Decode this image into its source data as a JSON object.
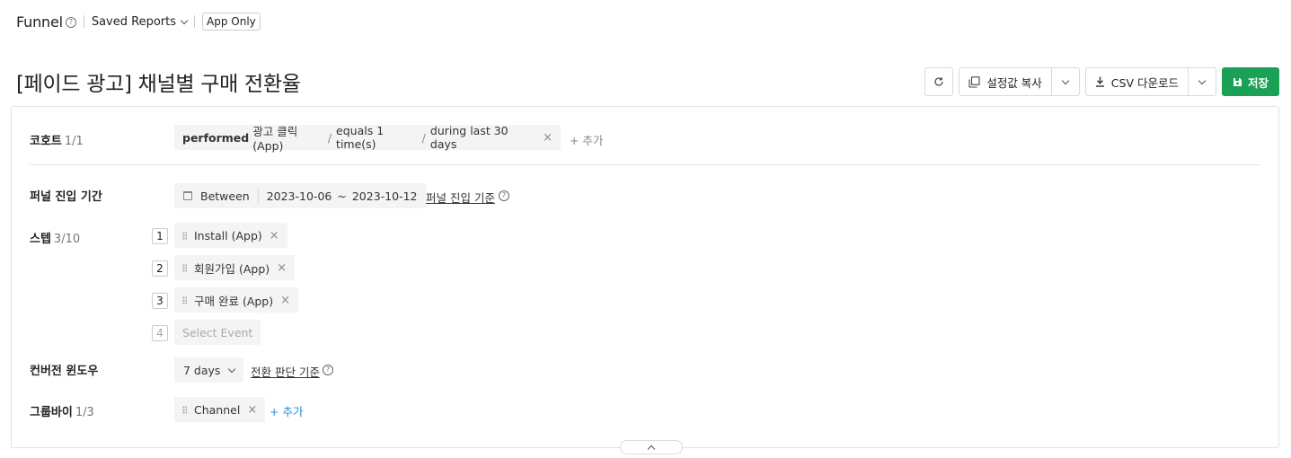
{
  "topbar": {
    "app_title": "Funnel",
    "help_glyph": "?",
    "saved_reports_label": "Saved Reports",
    "app_only_label": "App Only"
  },
  "page_title": "[페이드 광고] 채널별 구매 전환율",
  "toolbar": {
    "copy_label": "설정값 복사",
    "csv_label": "CSV 다운로드",
    "save_label": "저장"
  },
  "cohort": {
    "label": "코호트",
    "count": "1/1",
    "action": "performed",
    "event": "광고 클릭 (App)",
    "slash": "/",
    "condition": "equals 1 time(s)",
    "period": "during last 30 days",
    "remove": "×",
    "add_label": "+ 추가"
  },
  "entry_period": {
    "label": "퍼널 진입 기간",
    "mode": "Between",
    "start": "2023-10-06",
    "tilde": "~",
    "end": "2023-10-12",
    "criteria_link": "퍼널 진입 기준",
    "help_glyph": "?"
  },
  "steps": {
    "label": "스텝",
    "count": "3/10",
    "items": [
      {
        "num": "1",
        "name": "Install (App)"
      },
      {
        "num": "2",
        "name": "회원가입 (App)"
      },
      {
        "num": "3",
        "name": "구매 완료 (App)"
      }
    ],
    "next_num": "4",
    "placeholder": "Select Event",
    "remove": "×"
  },
  "conversion_window": {
    "label": "컨버전 윈도우",
    "value": "7 days",
    "criteria_link": "전환 판단 기준",
    "help_glyph": "?"
  },
  "group_by": {
    "label": "그룹바이",
    "count": "1/3",
    "item": "Channel",
    "remove": "×",
    "add_label": "+ 추가"
  },
  "colors": {
    "save_button": "#1aa155",
    "add_link": "#2b8fd6",
    "chip_bg": "#f4f4f4"
  },
  "icons": [
    "help-icon",
    "chevron-down-icon",
    "refresh-icon",
    "copy-icon",
    "download-icon",
    "save-icon",
    "calendar-icon",
    "drag-handle-icon",
    "close-icon",
    "chevron-up-icon"
  ]
}
